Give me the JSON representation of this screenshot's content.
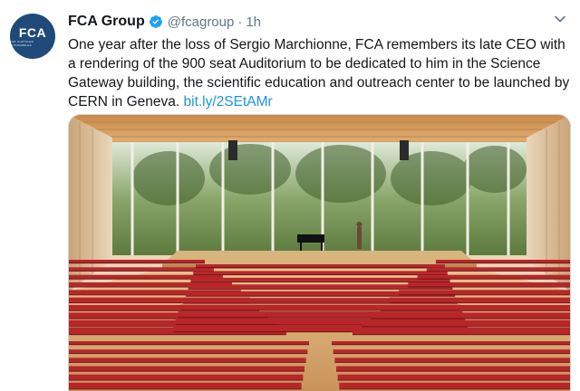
{
  "avatar": {
    "logo_text": "FCA",
    "sub_text": "FIAT CHRYSLER AUTOMOBILES",
    "color": "#1f4a7a"
  },
  "header": {
    "name": "FCA Group",
    "verified_icon": "verified-badge-icon",
    "handle": "@fcagroup",
    "separator": "·",
    "time": "1h"
  },
  "tweet": {
    "text": "One year after the loss of Sergio Marchionne, FCA remembers its late CEO with a rendering of the 900 seat Auditorium to be dedicated to him in the Science Gateway building, the scientific education and outreach center to be launched by CERN in Geneva. ",
    "link": "bit.ly/2SEtAMr"
  },
  "colors": {
    "link": "#1b95e0",
    "muted": "#657786",
    "seat_red": "#b8262a",
    "verified": "#1da1f2"
  },
  "icons": {
    "caret": "chevron-down-icon"
  }
}
